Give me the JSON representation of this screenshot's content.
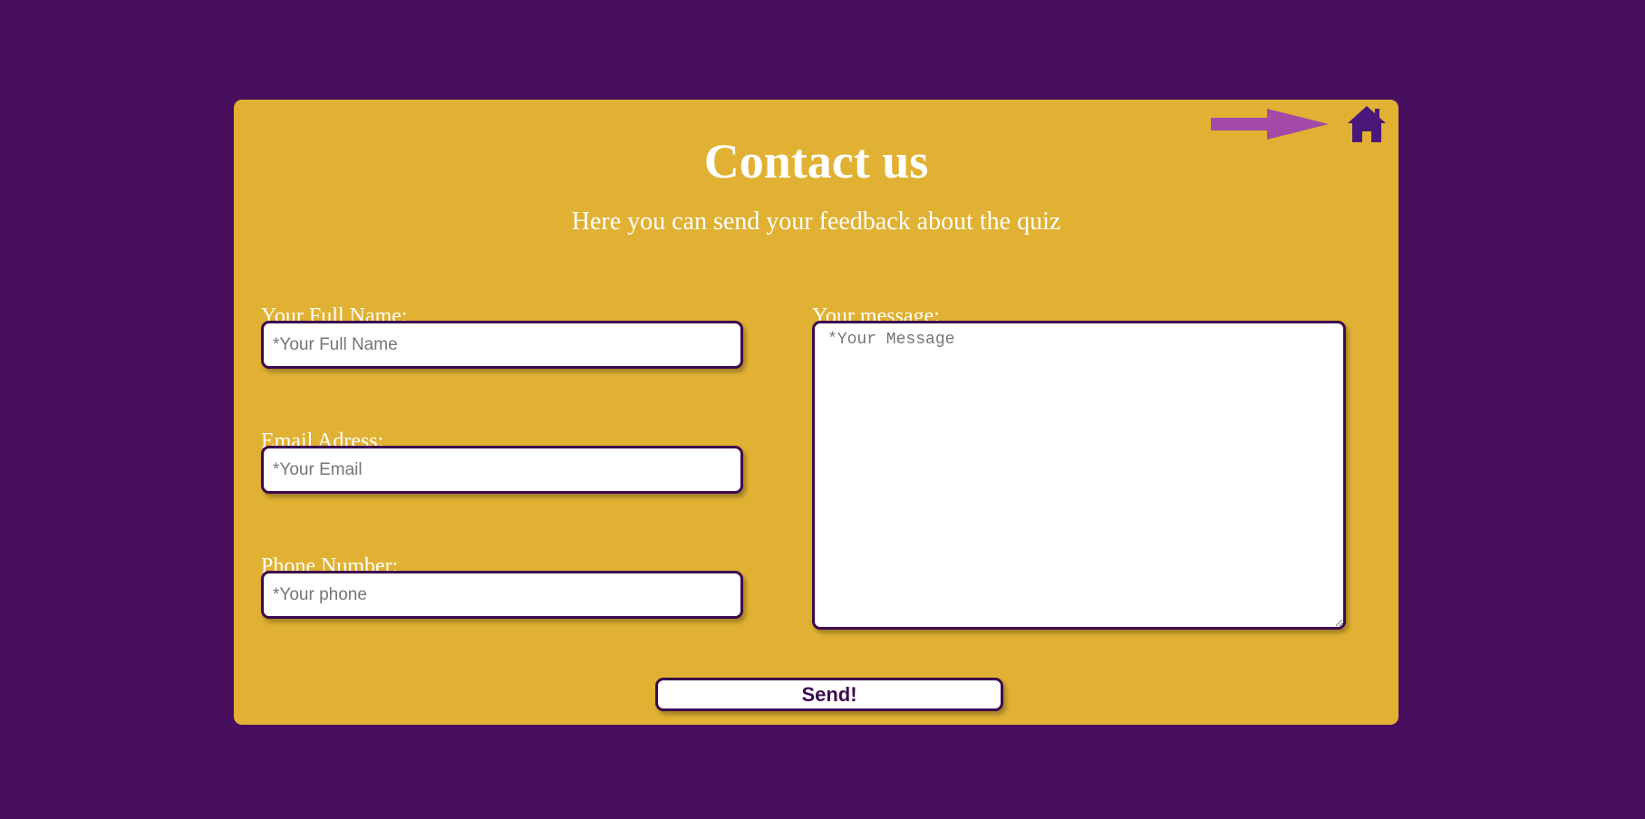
{
  "page": {
    "title": "Contact us",
    "subtitle": "Here you can send your feedback about the quiz"
  },
  "nav": {
    "arrow_icon": "arrow-right-icon",
    "home_icon": "home-icon"
  },
  "form": {
    "name": {
      "label": "Your Full Name:",
      "placeholder": "*Your Full Name",
      "value": ""
    },
    "email": {
      "label": "Email Adress:",
      "placeholder": "*Your Email",
      "value": ""
    },
    "phone": {
      "label": "Phone Number:",
      "placeholder": "*Your phone",
      "value": ""
    },
    "message": {
      "label": "Your message:",
      "placeholder": "*Your Message",
      "value": ""
    },
    "send_label": "Send!"
  },
  "colors": {
    "background": "#470f5e",
    "card": "#e0b133",
    "border": "#3d0a4f",
    "arrow": "#a34aa8",
    "home_icon": "#4a177a",
    "text": "#ffffff"
  }
}
